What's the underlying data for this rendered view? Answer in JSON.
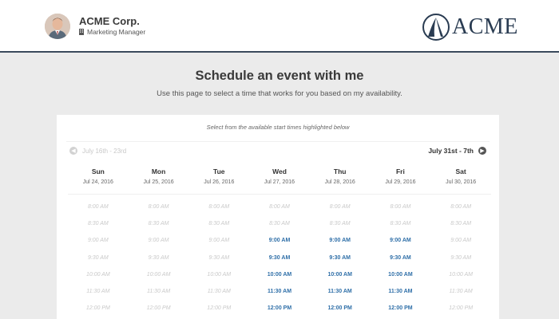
{
  "header": {
    "company": "ACME Corp.",
    "role": "Marketing Manager",
    "logo_text": "ACME"
  },
  "page": {
    "title": "Schedule an event with me",
    "subtitle": "Use this page to select a time that works for you based on my availability."
  },
  "calendar": {
    "hint": "Select from the available start times highlighted below",
    "prev_week": "July 16th - 23rd",
    "next_week": "July 31st - 7th",
    "days": [
      {
        "name": "Sun",
        "date": "Jul 24, 2016"
      },
      {
        "name": "Mon",
        "date": "Jul 25, 2016"
      },
      {
        "name": "Tue",
        "date": "Jul 26, 2016"
      },
      {
        "name": "Wed",
        "date": "Jul 27, 2016"
      },
      {
        "name": "Thu",
        "date": "Jul 28, 2016"
      },
      {
        "name": "Fri",
        "date": "Jul 29, 2016"
      },
      {
        "name": "Sat",
        "date": "Jul 30, 2016"
      }
    ],
    "times": [
      "8:00 AM",
      "8:30 AM",
      "9:00 AM",
      "9:30 AM",
      "10:00 AM",
      "11:30 AM",
      "12:00 PM"
    ],
    "times_note": "rows as shown in screenshot; available flags per day",
    "availability": [
      [
        false,
        false,
        false,
        false,
        false,
        false,
        false
      ],
      [
        false,
        false,
        false,
        false,
        false,
        false,
        false
      ],
      [
        false,
        false,
        false,
        true,
        true,
        true,
        false
      ],
      [
        false,
        false,
        false,
        true,
        true,
        true,
        false
      ],
      [
        false,
        false,
        false,
        true,
        true,
        true,
        false
      ],
      [
        false,
        false,
        false,
        true,
        true,
        true,
        false
      ],
      [
        false,
        false,
        false,
        true,
        true,
        true,
        false
      ]
    ]
  },
  "colors": {
    "accent": "#2f6fa8",
    "header_border": "#3a4a5c",
    "unavailable": "#c9c9c9"
  }
}
